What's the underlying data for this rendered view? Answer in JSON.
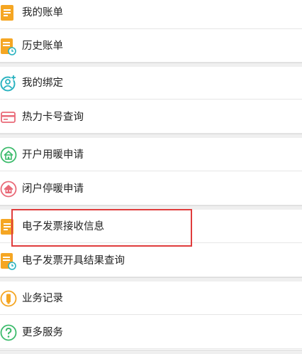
{
  "menu": {
    "items": [
      {
        "label": "我的账单",
        "icon": "bill-icon"
      },
      {
        "label": "历史账单",
        "icon": "history-bill-icon"
      },
      {
        "label": "我的绑定",
        "icon": "bind-user-icon"
      },
      {
        "label": "热力卡号查询",
        "icon": "card-icon"
      },
      {
        "label": "开户用暖申请",
        "icon": "house-heat-icon"
      },
      {
        "label": "闭户停暖申请",
        "icon": "house-stop-icon"
      },
      {
        "label": "电子发票接收信息",
        "icon": "invoice-icon"
      },
      {
        "label": "电子发票开具结果查询",
        "icon": "invoice-query-icon"
      },
      {
        "label": "业务记录",
        "icon": "record-icon"
      },
      {
        "label": "更多服务",
        "icon": "more-services-icon"
      }
    ],
    "highlighted_index": 6
  },
  "colors": {
    "orange": "#f5a623",
    "teal": "#2bb3c0",
    "pink": "#e96a78",
    "green": "#3dbb6c",
    "red_highlight": "#e03c3c",
    "divider": "#e6e6e6",
    "group_gap": "#efefef"
  }
}
